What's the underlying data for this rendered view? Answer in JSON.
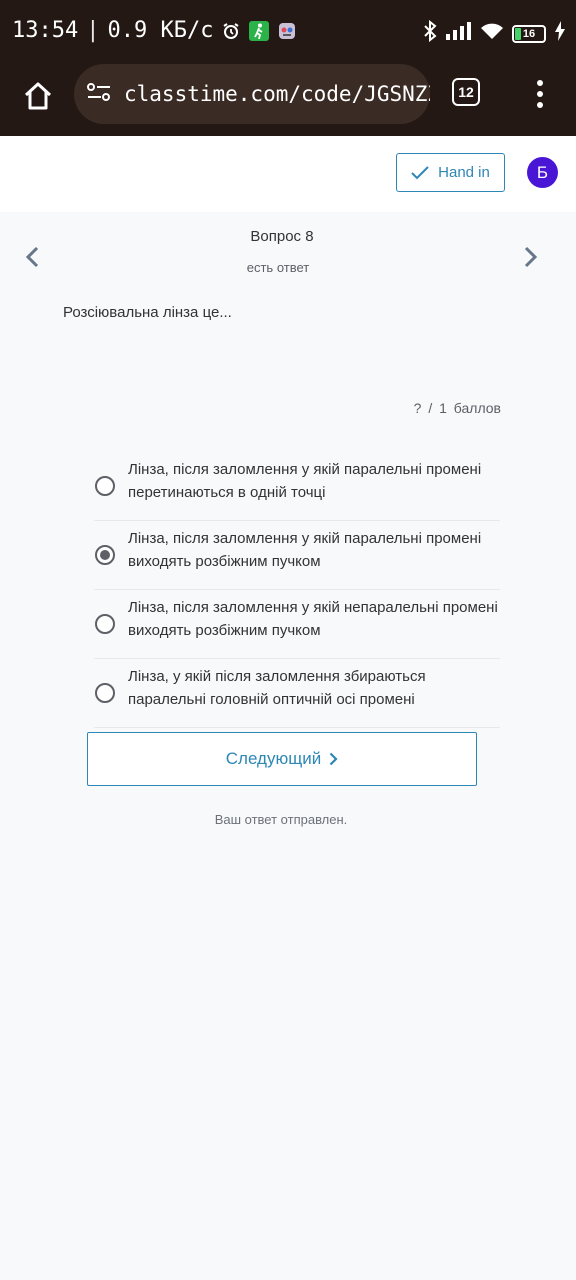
{
  "status_bar": {
    "time": "13:54",
    "separator": "|",
    "speed": "0.9 КБ/с",
    "icons": [
      "alarm-icon",
      "walking-app-icon",
      "app-icon"
    ],
    "right_icons": [
      "bluetooth-icon",
      "signal-icon",
      "wifi-icon",
      "battery-icon",
      "charging-icon"
    ],
    "battery_level": "16"
  },
  "browser": {
    "url": "classtime.com/code/JGSNZZ/",
    "tab_count": "12"
  },
  "header": {
    "hand_in_label": "Hand in",
    "avatar_letter": "Б",
    "accent_color": "#2e87b5",
    "avatar_color": "#4a16d6"
  },
  "question": {
    "title": "Вопрос 8",
    "status": "есть ответ",
    "text": "Розсіювальна лінза це...",
    "points": "? / 1 баллов"
  },
  "options": [
    {
      "label": "Лінза, після заломлення у якій паралельні промені перетинаються в одній точці",
      "selected": false
    },
    {
      "label": "Лінза, після заломлення у якій паралельні промені виходять розбіжним пучком",
      "selected": true
    },
    {
      "label": "Лінза, після заломлення у якій непаралельні промені виходять розбіжним пучком",
      "selected": false
    },
    {
      "label": "Лінза, у якій після заломлення збираються паралельні головній оптичній осі промені",
      "selected": false
    }
  ],
  "next_label": "Следующий",
  "sent_message": "Ваш ответ отправлен."
}
